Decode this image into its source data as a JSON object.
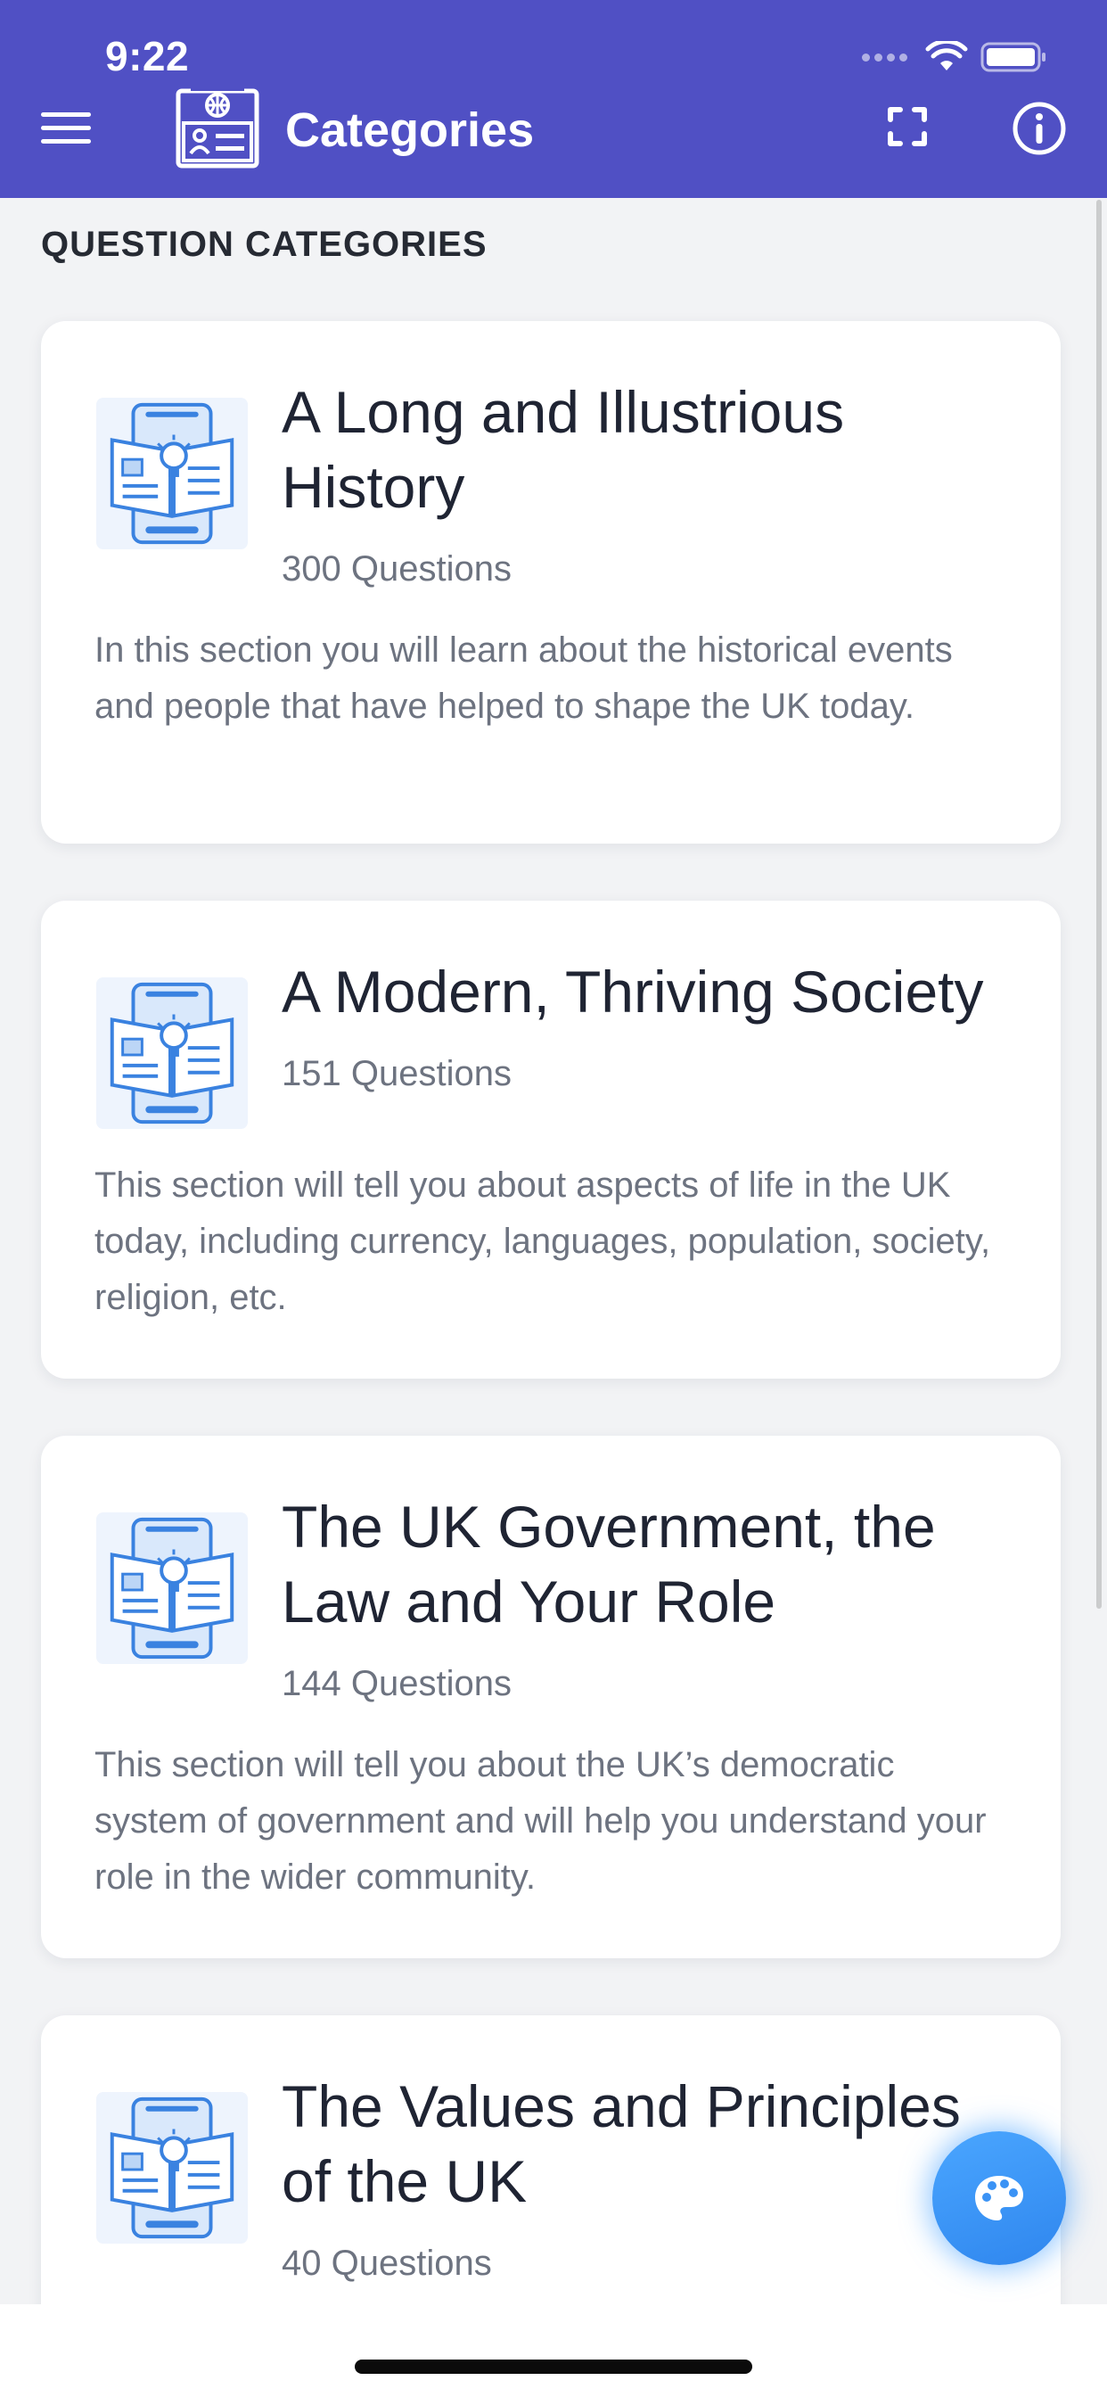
{
  "status_bar": {
    "time": "9:22"
  },
  "header": {
    "title": "Categories",
    "icons": {
      "menu": "hamburger-menu-icon",
      "logo": "citizenship-id-card-icon",
      "fullscreen": "fullscreen-icon",
      "info": "info-icon"
    },
    "background_color": "#5050c4"
  },
  "section": {
    "heading": "QUESTION CATEGORIES"
  },
  "categories": [
    {
      "title": "A Long and Illustrious History",
      "count": "300 Questions",
      "description": "In this section you will learn about the historical events and people that have helped to shape the UK today."
    },
    {
      "title": "A Modern, Thriving Society",
      "count": "151 Questions",
      "description": "This section will tell you about aspects of life in the UK today, including currency, languages, population, society, religion, etc."
    },
    {
      "title": "The UK Government, the Law and Your Role",
      "count": "144 Questions",
      "description": "This section will tell you about the UK’s democratic system of government and will help you understand your role in the wider community."
    },
    {
      "title": "The Values and Principles of the UK",
      "count": "40 Questions",
      "description": ""
    }
  ],
  "fab": {
    "icon": "palette-icon",
    "color": "#3b93f5"
  }
}
